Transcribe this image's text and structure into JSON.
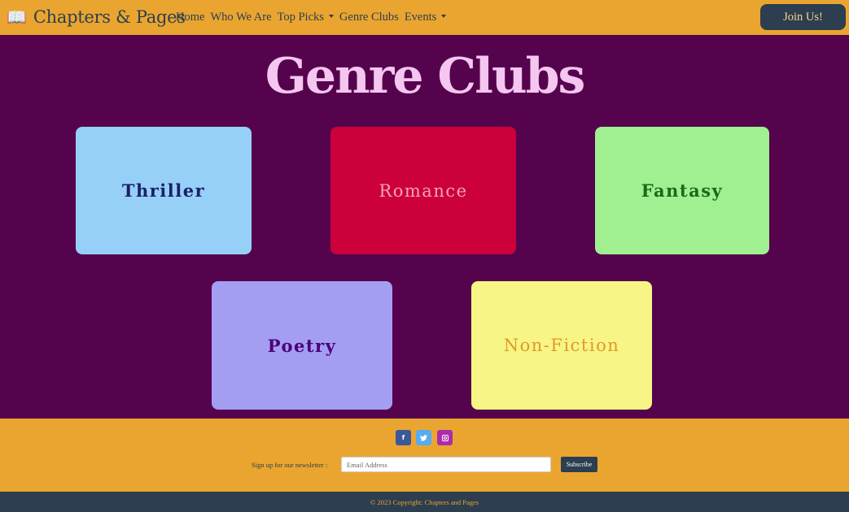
{
  "navbar": {
    "brand_icon": "📖",
    "brand_name": "Chapters & Pages",
    "links": [
      {
        "label": "Home"
      },
      {
        "label": "Who We Are"
      },
      {
        "label": "Top Picks"
      },
      {
        "label": "Genre Clubs"
      },
      {
        "label": "Events"
      }
    ],
    "join_label": "Join Us!"
  },
  "main": {
    "title": "Genre Clubs",
    "clubs": [
      {
        "label": "Thriller",
        "color": "#96d0f7"
      },
      {
        "label": "Romance",
        "color": "#cc003b"
      },
      {
        "label": "Fantasy",
        "color": "#a0ef91"
      },
      {
        "label": "Poetry",
        "color": "#a49ef3"
      },
      {
        "label": "Non-Fiction",
        "color": "#f7f585"
      }
    ]
  },
  "footer": {
    "social_icons": [
      "facebook-icon",
      "twitter-icon",
      "instagram-icon"
    ],
    "facebook_glyph": "f",
    "newsletter_label": "Sign up for our newsletter :",
    "email_placeholder": "Email Address",
    "subscribe_label": "Subscribe",
    "copyright": "© 2023 Copyright: Chapters and Pages"
  },
  "colors": {
    "accent": "#eaa530",
    "background": "#55034d",
    "dark": "#2c3e50"
  }
}
